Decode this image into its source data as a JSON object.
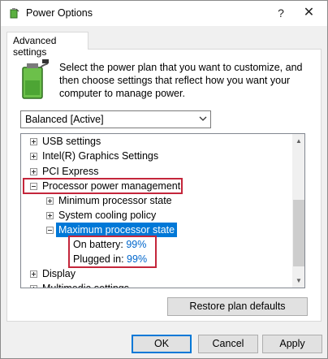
{
  "window": {
    "title": "Power Options",
    "help": "?",
    "close": "✕"
  },
  "tab": {
    "label": "Advanced settings"
  },
  "intro": {
    "text": "Select the power plan that you want to customize, and then choose settings that reflect how you want your computer to manage power."
  },
  "plan": {
    "selected": "Balanced [Active]"
  },
  "tree": {
    "items": [
      {
        "label": "USB settings",
        "expander": "plus"
      },
      {
        "label": "Intel(R) Graphics Settings",
        "expander": "plus"
      },
      {
        "label": "PCI Express",
        "expander": "plus"
      },
      {
        "label": "Processor power management",
        "expander": "minus"
      },
      {
        "label": "Minimum processor state",
        "expander": "plus"
      },
      {
        "label": "System cooling policy",
        "expander": "plus"
      },
      {
        "label": "Maximum processor state",
        "expander": "minus"
      },
      {
        "label": "Display",
        "expander": "plus"
      },
      {
        "label": "Multimedia settings",
        "expander": "plus"
      }
    ],
    "on_battery": {
      "label": "On battery:",
      "value": "99%"
    },
    "plugged_in": {
      "label": "Plugged in:",
      "value": "99%"
    }
  },
  "buttons": {
    "restore": "Restore plan defaults",
    "ok": "OK",
    "cancel": "Cancel",
    "apply": "Apply"
  },
  "colors": {
    "selection": "#0078d7",
    "highlight_box": "#c4263b",
    "link": "#0066cc"
  }
}
